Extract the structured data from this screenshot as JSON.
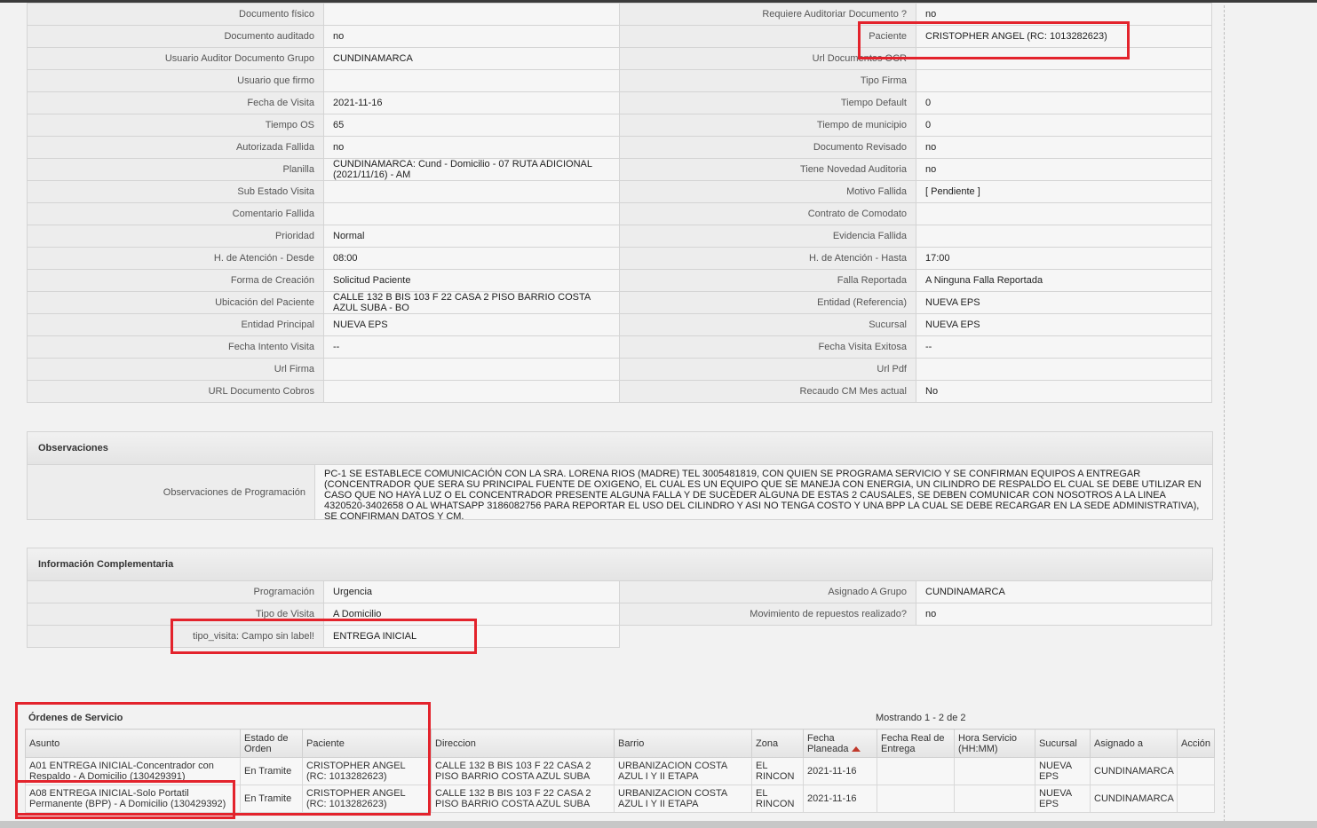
{
  "detail": {
    "rows": [
      {
        "l1": "Documento físico",
        "v1": "",
        "l2": "Requiere Auditoriar Documento ?",
        "v2": "no"
      },
      {
        "l1": "Documento auditado",
        "v1": "no",
        "l2": "Paciente",
        "v2": "CRISTOPHER ANGEL (RC: 1013282623)"
      },
      {
        "l1": "Usuario Auditor Documento Grupo",
        "v1": "CUNDINAMARCA",
        "l2": "Url Documentos OCR",
        "v2": ""
      },
      {
        "l1": "Usuario que firmo",
        "v1": "",
        "l2": "Tipo Firma",
        "v2": ""
      },
      {
        "l1": "Fecha de Visita",
        "v1": "2021-11-16",
        "l2": "Tiempo Default",
        "v2": "0"
      },
      {
        "l1": "Tiempo OS",
        "v1": "65",
        "l2": "Tiempo de municipio",
        "v2": "0"
      },
      {
        "l1": "Autorizada Fallida",
        "v1": "no",
        "l2": "Documento Revisado",
        "v2": "no"
      },
      {
        "l1": "Planilla",
        "v1": "CUNDINAMARCA: Cund - Domicilio - 07 RUTA ADICIONAL (2021/11/16) - AM",
        "l2": "Tiene Novedad Auditoria",
        "v2": "no"
      },
      {
        "l1": "Sub Estado Visita",
        "v1": "",
        "l2": "Motivo Fallida",
        "v2": "[ Pendiente ]"
      },
      {
        "l1": "Comentario Fallida",
        "v1": "",
        "l2": "Contrato de Comodato",
        "v2": ""
      },
      {
        "l1": "Prioridad",
        "v1": "Normal",
        "l2": "Evidencia Fallida",
        "v2": ""
      },
      {
        "l1": "H. de Atención - Desde",
        "v1": "08:00",
        "l2": "H. de Atención - Hasta",
        "v2": "17:00"
      },
      {
        "l1": "Forma de Creación",
        "v1": "Solicitud Paciente",
        "l2": "Falla Reportada",
        "v2": "A Ninguna Falla Reportada"
      },
      {
        "l1": "Ubicación del Paciente",
        "v1": "CALLE 132 B BIS 103 F 22 CASA 2 PISO BARRIO COSTA AZUL SUBA - BO",
        "l2": "Entidad (Referencia)",
        "v2": "NUEVA EPS"
      },
      {
        "l1": "Entidad Principal",
        "v1": "NUEVA EPS",
        "l2": "Sucursal",
        "v2": "NUEVA EPS"
      },
      {
        "l1": "Fecha Intento Visita",
        "v1": "--",
        "l2": "Fecha Visita Exitosa",
        "v2": "--"
      },
      {
        "l1": "Url Firma",
        "v1": "",
        "l2": "Url Pdf",
        "v2": ""
      },
      {
        "l1": "URL Documento Cobros",
        "v1": "",
        "l2": "Recaudo CM Mes actual",
        "v2": "No"
      }
    ]
  },
  "observaciones": {
    "title": "Observaciones",
    "label": "Observaciones de Programación",
    "text": "PC-1 SE ESTABLECE COMUNICACIÓN CON LA SRA. LORENA RIOS (MADRE) TEL 3005481819, CON QUIEN SE PROGRAMA SERVICIO Y SE CONFIRMAN EQUIPOS A ENTREGAR (CONCENTRADOR QUE SERA SU PRINCIPAL FUENTE DE OXIGENO, EL CUAL ES UN EQUIPO QUE SE MANEJA CON ENERGIA, UN CILINDRO DE RESPALDO EL CUAL SE DEBE UTILIZAR EN CASO QUE NO HAYA LUZ O EL CONCENTRADOR PRESENTE ALGUNA FALLA Y DE SUCEDER ALGUNA DE ESTAS 2 CAUSALES, SE DEBEN COMUNICAR CON NOSOTROS A LA LINEA 4320520-3402658 O AL WHATSAPP 3186082756 PARA REPORTAR EL USO DEL CILINDRO Y ASI NO TENGA COSTO Y UNA BPP LA CUAL SE DEBE RECARGAR EN LA SEDE ADMINISTRATIVA), SE CONFIRMAN DATOS Y CM."
  },
  "complementaria": {
    "title": "Información Complementaria",
    "rows": [
      {
        "l1": "Programación",
        "v1": "Urgencia",
        "l2": "Asignado A Grupo",
        "v2": "CUNDINAMARCA"
      },
      {
        "l1": "Tipo de Visita",
        "v1": "A Domicilio",
        "l2": "Movimiento de repuestos realizado?",
        "v2": "no"
      },
      {
        "l1": "tipo_visita: Campo sin label!",
        "v1": "ENTREGA INICIAL"
      }
    ]
  },
  "orders": {
    "title": "Órdenes de Servicio",
    "count": "Mostrando 1 - 2 de 2",
    "headers": [
      "Asunto",
      "Estado de Orden",
      "Paciente",
      "Direccion",
      "Barrio",
      "Zona",
      "Fecha Planeada",
      "Fecha Real de Entrega",
      "Hora Servicio (HH:MM)",
      "Sucursal",
      "Asignado a",
      "Acción"
    ],
    "rows": [
      [
        "A01 ENTREGA INICIAL-Concentrador con Respaldo - A Domicilio (130429391)",
        "En Tramite",
        "CRISTOPHER ANGEL (RC: 1013282623)",
        "CALLE 132 B BIS 103 F 22 CASA 2 PISO BARRIO COSTA AZUL SUBA",
        "URBANIZACION COSTA AZUL I Y II ETAPA",
        "EL RINCON",
        "2021-11-16",
        "",
        "",
        "NUEVA EPS",
        "CUNDINAMARCA",
        ""
      ],
      [
        "A08 ENTREGA INICIAL-Solo Portatil Permanente (BPP) - A Domicilio (130429392)",
        "En Tramite",
        "CRISTOPHER ANGEL (RC: 1013282623)",
        "CALLE 132 B BIS 103 F 22 CASA 2 PISO BARRIO COSTA AZUL SUBA",
        "URBANIZACION COSTA AZUL I Y II ETAPA",
        "EL RINCON",
        "2021-11-16",
        "",
        "",
        "NUEVA EPS",
        "CUNDINAMARCA",
        ""
      ]
    ]
  },
  "colors": {
    "highlight": "#e3232c",
    "sort_arrow": "#c0392b"
  }
}
